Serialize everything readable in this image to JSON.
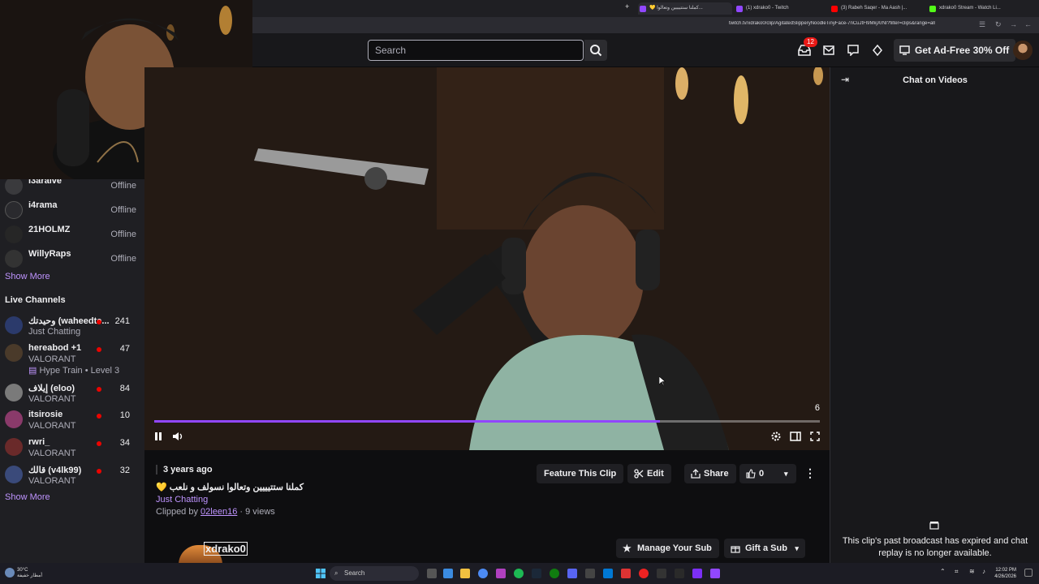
{
  "browser": {
    "tabs": [
      {
        "title": "💛 كملنا ستتيييين وتعالوا...",
        "color": "#9147ff",
        "active": true
      },
      {
        "title": "(1) xdrako0 - Twitch",
        "color": "#9147ff",
        "active": false
      },
      {
        "title": "(3) Rabeh Saqer - Ma Aash |...",
        "color": "#ff0000",
        "active": false
      },
      {
        "title": "xdrako0 Stream - Watch Li...",
        "color": "#53fc18",
        "active": false
      }
    ],
    "url": "twitch.tv/xdrako0/clip/AgitatedSlipperyNoodleTinyFace-7nCuJtFl9MkjXrNI?filter=clips&range=all"
  },
  "topnav": {
    "search_placeholder": "Search",
    "notifications_count": "12",
    "ad_free_label": "Get Ad-Free 30% Off"
  },
  "sidebar": {
    "offline_channels": [
      {
        "name": "i3araive",
        "status": "Offline"
      },
      {
        "name": "i4rama",
        "status": "Offline"
      },
      {
        "name": "21HOLMZ",
        "status": "Offline"
      },
      {
        "name": "WillyRaps",
        "status": "Offline"
      }
    ],
    "show_more_1": "Show More",
    "live_heading": "Live Channels",
    "live_channels": [
      {
        "name": "وحيدتك (waheedte...",
        "category": "Just Chatting",
        "viewers": "241",
        "color": "#2b3a6b"
      },
      {
        "name": "hereabod +1",
        "category": "VALORANT",
        "extra": "Hype Train • Level 3",
        "viewers": "47",
        "color": "#4a3a2a"
      },
      {
        "name": "إيلاف (eloo)",
        "category": "VALORANT",
        "viewers": "84",
        "color": "#7a7a7a"
      },
      {
        "name": "itsirosie",
        "category": "VALORANT",
        "viewers": "10",
        "color": "#8a3a6a"
      },
      {
        "name": "rwri_",
        "category": "VALORANT",
        "viewers": "34",
        "color": "#6a2a2a"
      },
      {
        "name": "قالك (v4lk99)",
        "category": "VALORANT",
        "viewers": "32",
        "color": "#3a4a7a"
      }
    ],
    "show_more_2": "Show More"
  },
  "player": {
    "progress": 0.76,
    "counter": "6"
  },
  "clip": {
    "time_ago": "3 years ago",
    "title": "كملنا ستتيييين وتعالوا نسولف و نلعب 💛",
    "category": "Just Chatting",
    "clipped_by_prefix": "Clipped by",
    "clipper": "02leen16",
    "views": "· 9 views",
    "feature_label": "Feature This Clip",
    "edit_label": "Edit",
    "share_label": "Share",
    "likes": "0",
    "streamer": "xdrako0",
    "manage_sub_label": "Manage Your Sub",
    "gift_sub_label": "Gift a Sub"
  },
  "chat": {
    "title": "Chat on Videos",
    "message": "This clip's past broadcast has expired and chat replay is no longer available."
  },
  "taskbar": {
    "search_label": "Search",
    "weather_temp": "30°C",
    "weather_desc": "أمطار خفيفة",
    "time": "12:02 PM",
    "date": "4/26/2026"
  },
  "colors": {
    "accent": "#9147ff",
    "link": "#bf94ff",
    "live": "#eb0400"
  }
}
